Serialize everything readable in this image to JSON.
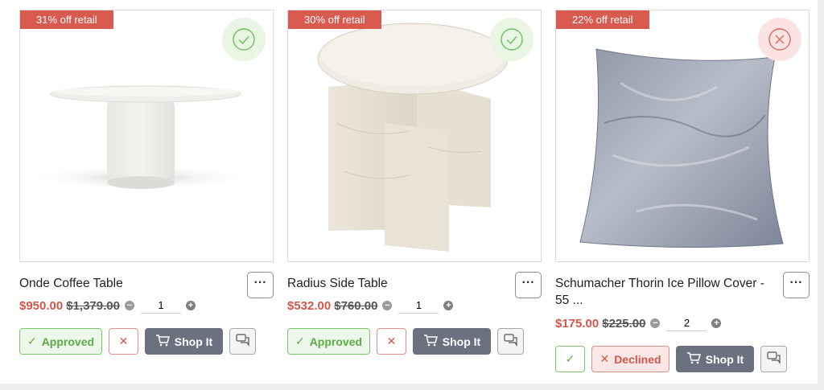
{
  "colors": {
    "badge": "#d95a4e",
    "sale_price": "#d2574a",
    "approve": "#5aaa48",
    "decline": "#d2574a",
    "shop_button": "#6c7180"
  },
  "products": [
    {
      "badge": "31% off retail",
      "status_icon": "check-circle-icon",
      "name": "Onde Coffee Table",
      "sale_price": "$950.00",
      "original_price": "$1,379.00",
      "quantity": "1",
      "approve_label": "Approved",
      "decline_label": "",
      "shop_label": "Shop It"
    },
    {
      "badge": "30% off retail",
      "status_icon": "check-circle-icon",
      "name": "Radius Side Table",
      "sale_price": "$532.00",
      "original_price": "$760.00",
      "quantity": "1",
      "approve_label": "Approved",
      "decline_label": "",
      "shop_label": "Shop It"
    },
    {
      "badge": "22% off retail",
      "status_icon": "x-circle-icon",
      "name": "Schumacher Thorin Ice Pillow Cover - 55 ...",
      "sale_price": "$175.00",
      "original_price": "$225.00",
      "quantity": "2",
      "approve_label": "",
      "decline_label": "Declined",
      "shop_label": "Shop It"
    }
  ],
  "icons": {
    "more": "more-dots-icon",
    "minus": "minus-circle-icon",
    "plus": "plus-circle-icon",
    "check": "check-icon",
    "close": "close-icon",
    "cart": "cart-icon",
    "chat": "chat-bubbles-icon"
  },
  "more_label": "···"
}
